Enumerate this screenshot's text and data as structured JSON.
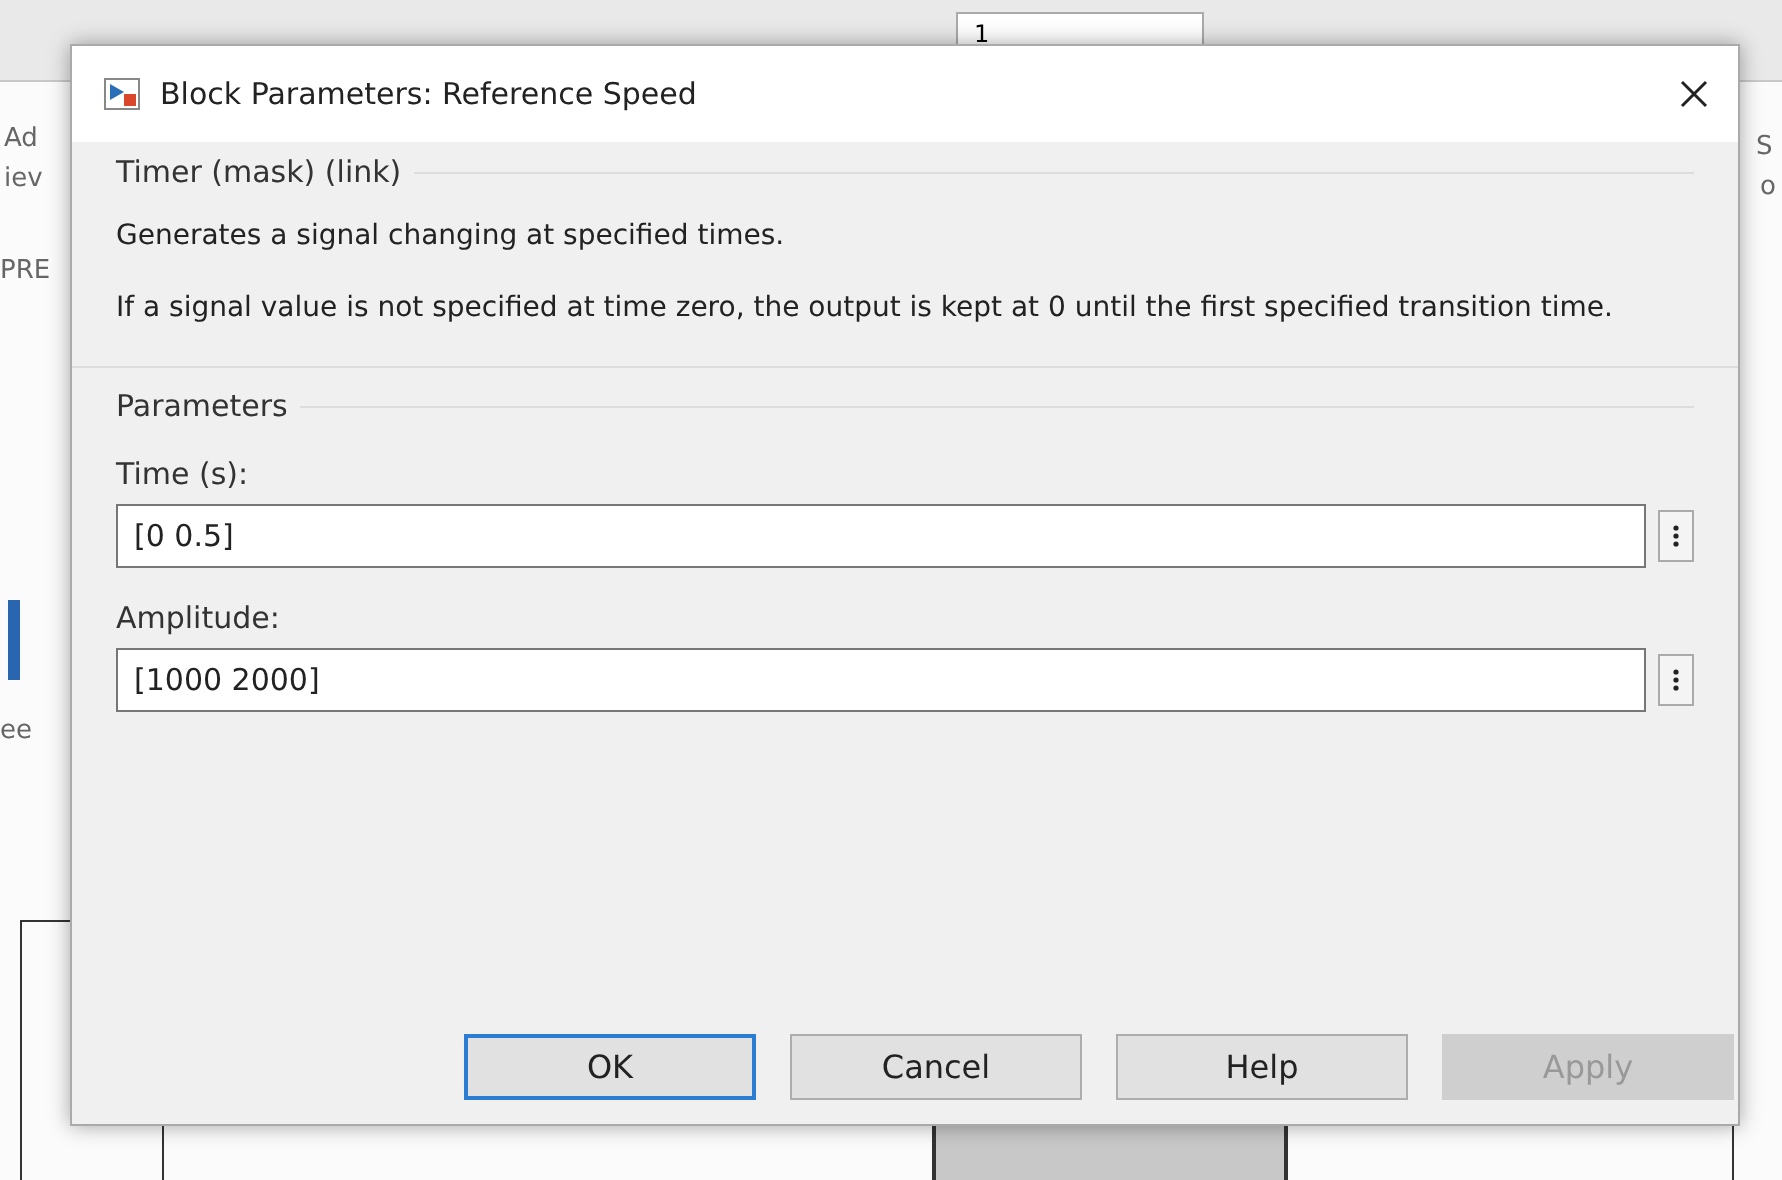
{
  "background": {
    "fragments": [
      {
        "text": "Ad"
      },
      {
        "text": "iev"
      },
      {
        "text": "PRE"
      },
      {
        "text": "ee"
      },
      {
        "text": "S"
      },
      {
        "text": "o"
      }
    ],
    "stop_time_value": "1"
  },
  "window": {
    "title": "Block Parameters: Reference Speed"
  },
  "block_type": "Timer (mask) (link)",
  "description": [
    "Generates a signal changing at specified times.",
    "If a signal value is not specified at time zero, the output is kept at 0 until the first specified transition time."
  ],
  "parameters": {
    "title": "Parameters",
    "fields": [
      {
        "label": "Time (s):",
        "value": "[0 0.5]"
      },
      {
        "label": "Amplitude:",
        "value": "[1000 2000]"
      }
    ]
  },
  "buttons": [
    {
      "label": "OK",
      "default": true,
      "disabled": false
    },
    {
      "label": "Cancel",
      "default": false,
      "disabled": false
    },
    {
      "label": "Help",
      "default": false,
      "disabled": false
    },
    {
      "label": "Apply",
      "default": false,
      "disabled": true
    }
  ]
}
